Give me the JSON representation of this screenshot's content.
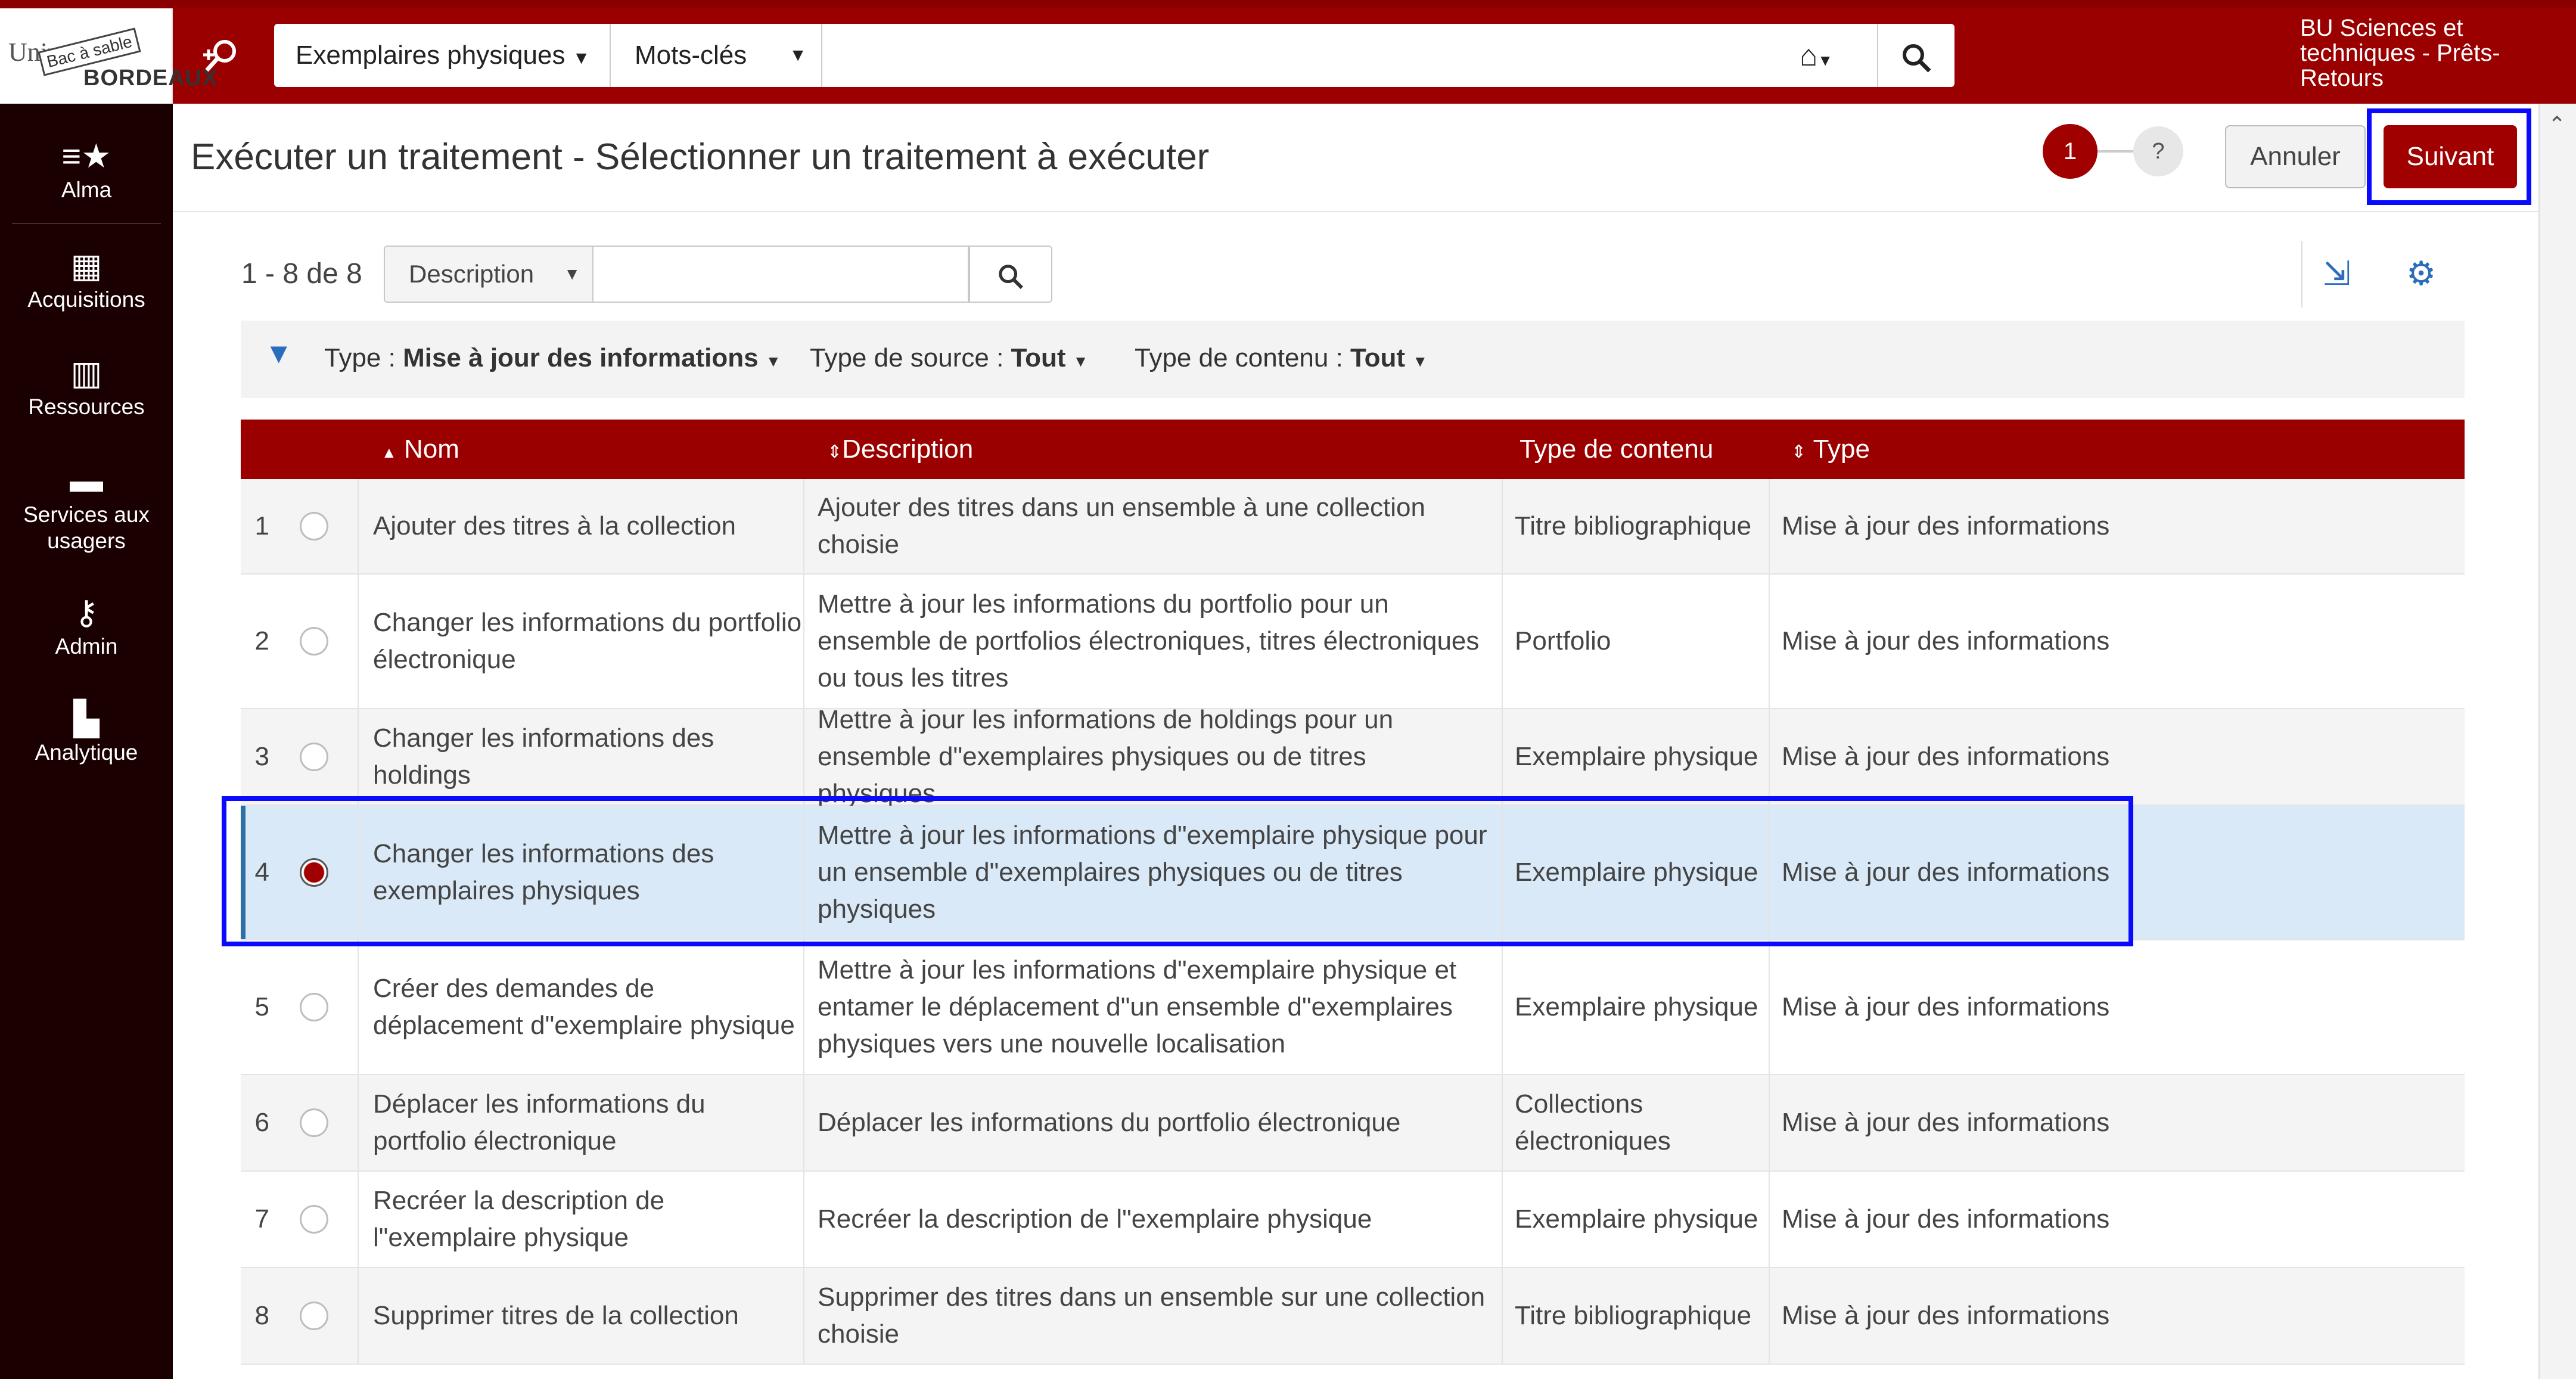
{
  "header": {
    "logo_text_1": "Univ",
    "logo_stamp": "Bac à sable",
    "logo_text_2": "BORDEAUX",
    "search_type": "Exemplaires physiques",
    "search_field": "Mots-clés",
    "search_value": "",
    "library": "BU Sciences et techniques - Prêts-Retours"
  },
  "sidebar": {
    "items": [
      {
        "label": "Alma",
        "icon": "menu-star-icon"
      },
      {
        "label": "Acquisitions",
        "icon": "abacus-icon"
      },
      {
        "label": "Ressources",
        "icon": "books-icon"
      },
      {
        "label": "Services aux usagers",
        "icon": "desk-icon"
      },
      {
        "label": "Admin",
        "icon": "wrench-icon"
      },
      {
        "label": "Analytique",
        "icon": "bar-chart-icon"
      }
    ]
  },
  "page": {
    "title": "Exécuter un traitement - Sélectionner un traitement à exécuter",
    "step_current": "1",
    "step_next": "?",
    "cancel_label": "Annuler",
    "next_label": "Suivant"
  },
  "list": {
    "count": "1 - 8 de 8",
    "search_field": "Description",
    "search_value": ""
  },
  "filters": {
    "type_label": "Type :",
    "type_value": "Mise à jour des informations",
    "source_label": "Type de source :",
    "source_value": "Tout",
    "content_label": "Type de contenu :",
    "content_value": "Tout"
  },
  "table": {
    "columns": [
      "Nom",
      "Description",
      "Type de contenu",
      "Type"
    ],
    "rows": [
      {
        "num": "1",
        "name": "Ajouter des titres à la collection",
        "desc": "Ajouter des titres dans un ensemble à une collection choisie",
        "content": "Titre bibliographique",
        "type": "Mise à jour des informations",
        "selected": false
      },
      {
        "num": "2",
        "name": "Changer les informations du portfolio électronique",
        "desc": "Mettre à jour les informations du portfolio pour un ensemble de portfolios électroniques, titres électroniques ou tous les titres",
        "content": "Portfolio",
        "type": "Mise à jour des informations",
        "selected": false
      },
      {
        "num": "3",
        "name": "Changer les informations des holdings",
        "desc": "Mettre à jour les informations de holdings pour un ensemble d\"exemplaires physiques ou de titres physiques",
        "content": "Exemplaire physique",
        "type": "Mise à jour des informations",
        "selected": false
      },
      {
        "num": "4",
        "name": "Changer les informations des exemplaires physiques",
        "desc": "Mettre à jour les informations d\"exemplaire physique pour un ensemble d\"exemplaires physiques ou de titres physiques",
        "content": "Exemplaire physique",
        "type": "Mise à jour des informations",
        "selected": true
      },
      {
        "num": "5",
        "name": "Créer des demandes de déplacement d\"exemplaire physique",
        "desc": "Mettre à jour les informations d\"exemplaire physique et entamer le déplacement d\"un ensemble d\"exemplaires physiques vers une nouvelle localisation",
        "content": "Exemplaire physique",
        "type": "Mise à jour des informations",
        "selected": false
      },
      {
        "num": "6",
        "name": "Déplacer les informations du portfolio électronique",
        "desc": "Déplacer les informations du portfolio électronique",
        "content": "Collections électroniques",
        "type": "Mise à jour des informations",
        "selected": false
      },
      {
        "num": "7",
        "name": "Recréer la description de l\"exemplaire physique",
        "desc": "Recréer la description de l\"exemplaire physique",
        "content": "Exemplaire physique",
        "type": "Mise à jour des informations",
        "selected": false
      },
      {
        "num": "8",
        "name": "Supprimer titres de la collection",
        "desc": "Supprimer des titres dans un ensemble sur une collection choisie",
        "content": "Titre bibliographique",
        "type": "Mise à jour des informations",
        "selected": false
      }
    ]
  },
  "colors": {
    "brand_red": "#9b0000",
    "sidebar_bg": "#1a0000",
    "selection_bg": "#d9e9f7",
    "highlight_box": "#0a0aff",
    "link_blue": "#2a6ebb"
  }
}
